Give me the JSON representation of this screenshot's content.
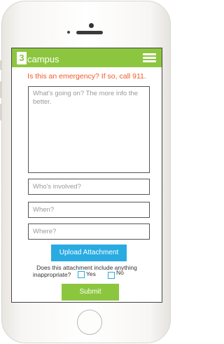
{
  "app": {
    "logo_mark": "3",
    "logo_text": "campus",
    "brand_color": "#8cc63f",
    "accent_color": "#29abe2",
    "alert_color": "#f15a24"
  },
  "header": {
    "menu_icon": "hamburger-menu-icon"
  },
  "form": {
    "emergency_notice": "Is this an emergency? If so, call 911.",
    "description_placeholder": "What's going on? The more info the better.",
    "who_placeholder": "Who's involved?",
    "when_placeholder": "When?",
    "where_placeholder": "Where?",
    "upload_label": "Upload Attachment",
    "question_line1": "Does this attachment include anything",
    "question_line2": "inappropriate?",
    "yes_label": "Yes",
    "no_label": "No",
    "submit_label": "Submit"
  }
}
